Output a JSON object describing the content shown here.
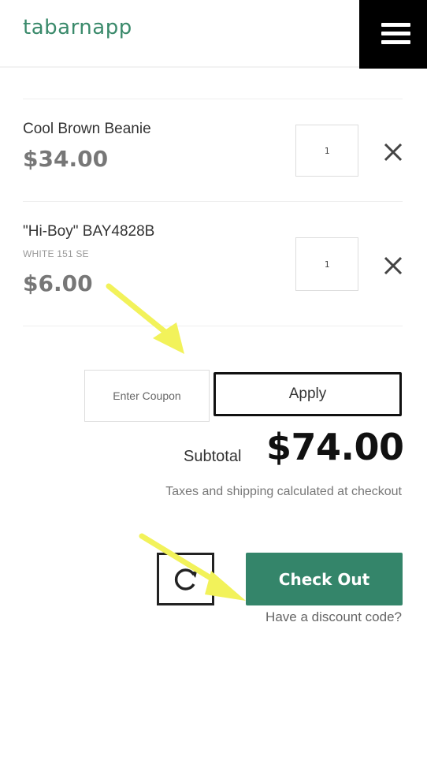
{
  "header": {
    "logo": "tabarnapp",
    "menu_icon": "hamburger-menu-icon"
  },
  "cart": {
    "items": [
      {
        "name": "Cool Brown Beanie",
        "variant": "",
        "price": "$34.00",
        "quantity": "1",
        "remove_icon": "close-icon"
      },
      {
        "name": "\"Hi-Boy\" BAY4828B",
        "variant": "WHITE 151 SE",
        "price": "$6.00",
        "quantity": "1",
        "remove_icon": "close-icon"
      }
    ]
  },
  "coupon": {
    "placeholder": "Enter Coupon",
    "value": "",
    "apply_label": "Apply"
  },
  "summary": {
    "subtotal_label": "Subtotal",
    "subtotal_value": "$74.00",
    "tax_note": "Taxes and shipping calculated at checkout"
  },
  "actions": {
    "refresh_icon": "refresh-icon",
    "checkout_label": "Check Out",
    "discount_link": "Have a discount code?"
  },
  "colors": {
    "brand": "#3a8a6b",
    "checkout": "#34856a",
    "annotation_arrow": "#f2f25a"
  }
}
